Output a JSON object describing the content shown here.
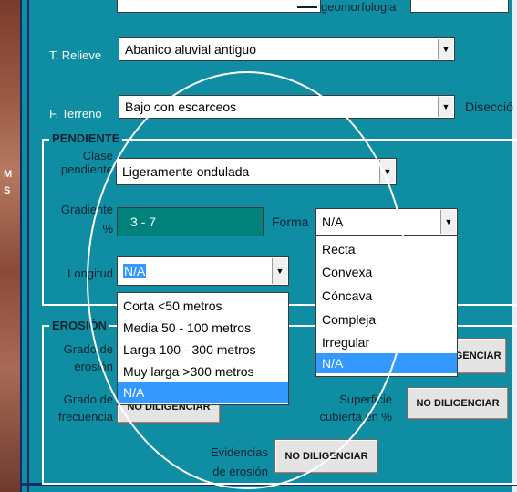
{
  "left_strip": {
    "text_lines": [
      "M",
      "S"
    ]
  },
  "top_fragment": {
    "label": "geomorfologia"
  },
  "relieve": {
    "label": "T. Relieve",
    "value": "Abanico aluvial antiguo"
  },
  "terreno": {
    "label": "F. Terreno",
    "value": "Bajo con escarceos",
    "side_label": "Disecció"
  },
  "pendiente": {
    "title": "PENDIENTE",
    "clase_label_1": "Clase",
    "clase_label_2": "pendiente",
    "clase_value": "Ligeramente ondulada",
    "gradiente_label_1": "Gradiente",
    "gradiente_label_2": "%",
    "gradiente_value": "3 - 7",
    "forma_label": "Forma",
    "forma_value": "N/A",
    "forma_options": [
      "Recta",
      "Convexa",
      "Cóncava",
      "Compleja",
      "Irregular",
      "N/A"
    ],
    "forma_selected": "N/A",
    "longitud_label": "Longitud",
    "longitud_value": "N/A",
    "longitud_options": [
      "Corta <50 metros",
      "Media 50 - 100 metros",
      "Larga 100 - 300 metros",
      "Muy larga >300 metros",
      "N/A"
    ],
    "longitud_selected": "N/A"
  },
  "erosion": {
    "title": "EROSIÓN",
    "grado_label_1": "Grado de",
    "grado_label_2": "erosión",
    "grado_button": "NO DILIGENCIAR",
    "frecuencia_label_1": "Grado de",
    "frecuencia_label_2": "frecuencia",
    "frecuencia_button": "NO DILIGENCIAR",
    "superficie_label_1": "Superficie",
    "superficie_label_2": "cubierta en %",
    "superficie_button": "NO DILIGENCIAR",
    "evidencias_label_1": "Evidencias",
    "evidencias_label_2": "de erosión",
    "evidencias_button": "NO DILIGENCIAR"
  },
  "colors": {
    "panel": "#0f8ea3",
    "teal_box": "#00817a",
    "selection": "#3399ff"
  }
}
